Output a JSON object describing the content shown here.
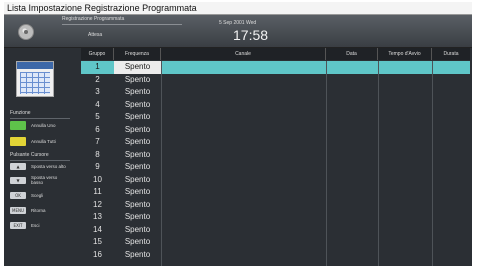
{
  "window": {
    "title": "Lista Impostazione Registrazione Programmata"
  },
  "header": {
    "mode_label": "Registrazione Programmata",
    "status": "Attesa",
    "date": "5 Sep 2001 Wed",
    "time": "17:58"
  },
  "sidebar": {
    "function_title": "Funzione",
    "functions": [
      {
        "label": "Annulla Uno",
        "color": "#5ec24a"
      },
      {
        "label": "Annulla Tutti",
        "color": "#e2d436"
      }
    ],
    "controls_title": "Pulsante Cursore",
    "controls": [
      {
        "key": "▲",
        "label": "Sposta verso alto"
      },
      {
        "key": "▼",
        "label": "Sposta verso basso"
      },
      {
        "key": "OK",
        "label": "Scegli"
      },
      {
        "key": "MENU",
        "label": "Ritorna"
      },
      {
        "key": "EXIT",
        "label": "Esci"
      }
    ]
  },
  "table": {
    "columns": [
      "Gruppo",
      "Frequenza",
      "Canale",
      "Data",
      "Tempo d'Avvio",
      "Durata"
    ],
    "selected_row": 0,
    "rows": [
      {
        "group": "1",
        "frequency": "Spento"
      },
      {
        "group": "2",
        "frequency": "Spento"
      },
      {
        "group": "3",
        "frequency": "Spento"
      },
      {
        "group": "4",
        "frequency": "Spento"
      },
      {
        "group": "5",
        "frequency": "Spento"
      },
      {
        "group": "6",
        "frequency": "Spento"
      },
      {
        "group": "7",
        "frequency": "Spento"
      },
      {
        "group": "8",
        "frequency": "Spento"
      },
      {
        "group": "9",
        "frequency": "Spento"
      },
      {
        "group": "10",
        "frequency": "Spento"
      },
      {
        "group": "11",
        "frequency": "Spento"
      },
      {
        "group": "12",
        "frequency": "Spento"
      },
      {
        "group": "13",
        "frequency": "Spento"
      },
      {
        "group": "14",
        "frequency": "Spento"
      },
      {
        "group": "15",
        "frequency": "Spento"
      },
      {
        "group": "16",
        "frequency": "Spento"
      }
    ]
  },
  "colors": {
    "selection": "#5fc6c8",
    "background": "#2b2f34"
  }
}
